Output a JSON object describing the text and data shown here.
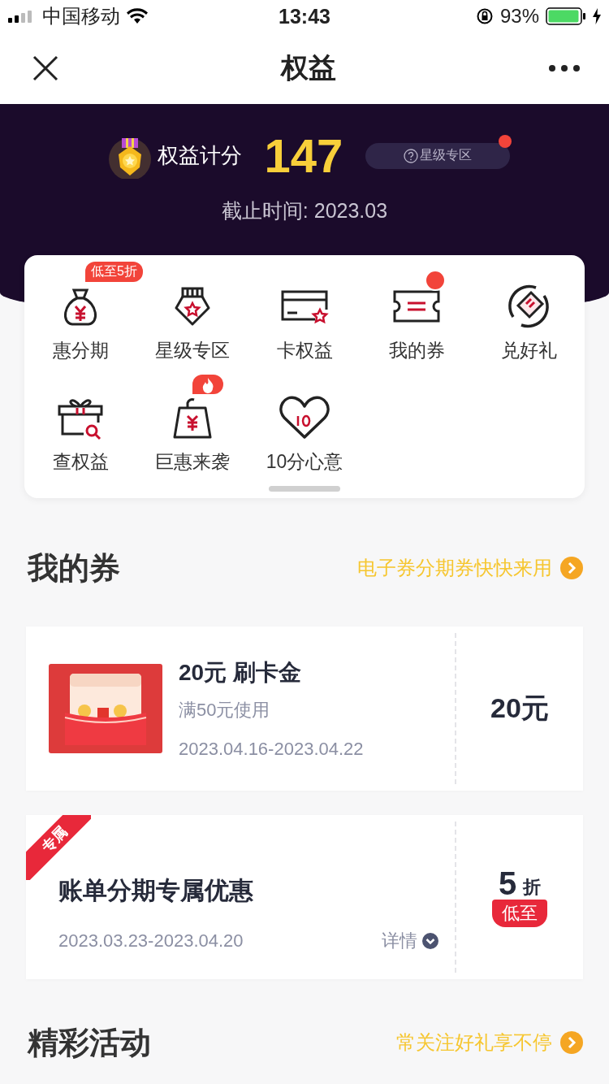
{
  "status_bar": {
    "carrier": "中国移动",
    "time": "13:43",
    "battery": "93%"
  },
  "nav": {
    "title": "权益"
  },
  "header": {
    "score_label": "权益计分",
    "score": "147",
    "star_zone": {
      "label": "星级专区",
      "notice": true
    },
    "deadline": "截止时间: 2023.03"
  },
  "menu": [
    {
      "label": "惠分期",
      "badge": {
        "kind": "text",
        "text": "低至5折"
      }
    },
    {
      "label": "星级专区"
    },
    {
      "label": "卡权益"
    },
    {
      "label": "我的券",
      "badge": {
        "kind": "dot"
      }
    },
    {
      "label": "兑好礼"
    },
    {
      "label": "查权益"
    },
    {
      "label": "巨惠来袭",
      "badge": {
        "kind": "fire"
      }
    },
    {
      "label": "10分心意"
    }
  ],
  "coupon_section": {
    "title": "我的券",
    "link": "电子券分期券快快来用"
  },
  "coupons": [
    {
      "kind": "voucher",
      "title": "20元 刷卡金",
      "condition": "满50元使用",
      "dates": "2023.04.16-2023.04.22",
      "value": "20元"
    },
    {
      "kind": "discount",
      "ribbon": "专属",
      "title": "账单分期专属优惠",
      "dates": "2023.03.23-2023.04.20",
      "detail": "详情",
      "value": "5",
      "unit": "折",
      "tag": "低至"
    }
  ],
  "activity_section": {
    "title": "精彩活动",
    "link": "常关注好礼享不停"
  }
}
